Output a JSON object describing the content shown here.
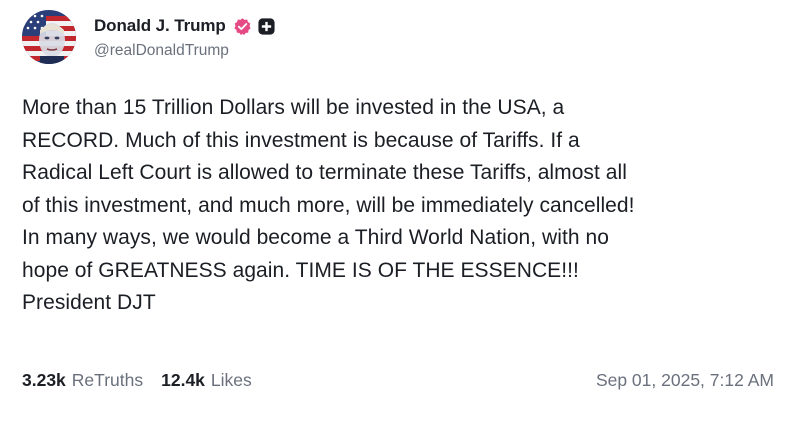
{
  "author": {
    "display_name": "Donald J. Trump",
    "handle": "@realDonaldTrump",
    "avatar_icon": "avatar-flag-portrait",
    "verified_icon": "verified-badge-icon",
    "verified_color": "#e54a84",
    "plus_icon": "plus-badge-icon"
  },
  "post": {
    "text": "More than 15 Trillion Dollars will be invested in the USA, a\nRECORD. Much of this investment is because of Tariffs. If a\nRadical Left Court is allowed to terminate these Tariffs, almost all\nof this investment, and much more, will be immediately cancelled!\nIn many ways, we would become a Third World Nation, with no\nhope of GREATNESS again. TIME IS OF THE ESSENCE!!!\nPresident DJT"
  },
  "stats": {
    "retruths_count": "3.23k",
    "retruths_label": "ReTruths",
    "likes_count": "12.4k",
    "likes_label": "Likes"
  },
  "timestamp": "Sep 01, 2025, 7:12 AM",
  "colors": {
    "text_primary": "#1b1e24",
    "text_secondary": "#6a717d",
    "background": "#ffffff"
  }
}
